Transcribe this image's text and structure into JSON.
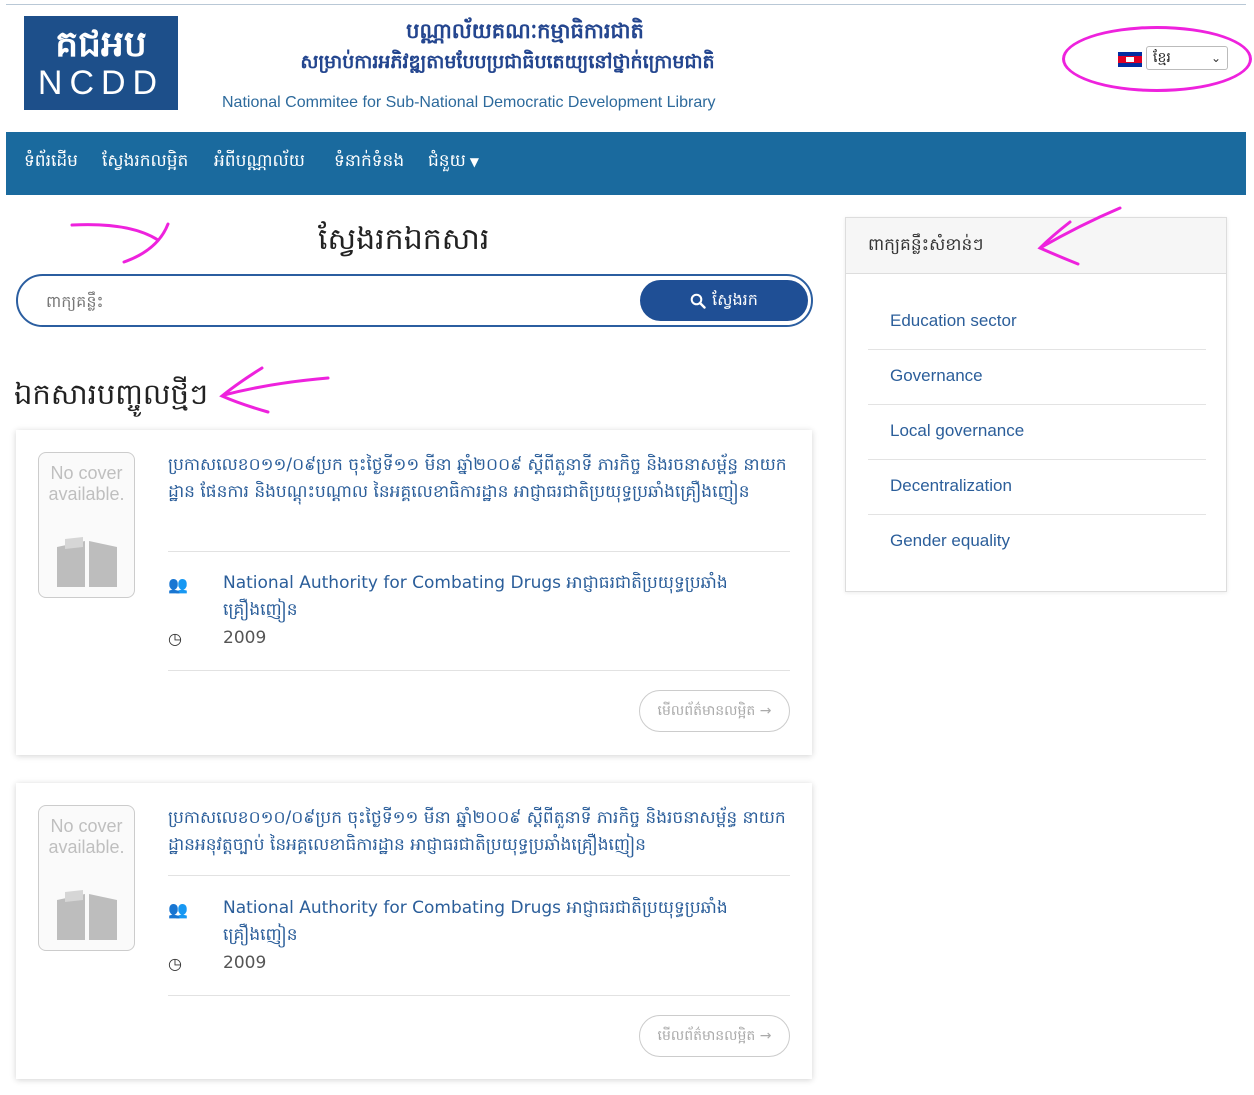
{
  "header": {
    "logo_khmer": "គជអប",
    "logo_latin": "NCDD",
    "title_khmer_line1": "បណ្ណាល័យគណៈកម្មាធិការជាតិ",
    "title_khmer_line2": "សម្រាប់ការអភិវឌ្ឍតាមបែបប្រជាធិបតេយ្យនៅថ្នាក់ក្រោមជាតិ",
    "title_english": "National Commitee for Sub-National Democratic Development Library",
    "language": {
      "selected": "ខ្មែរ",
      "flag_icon": "cambodia-flag-icon"
    }
  },
  "nav": {
    "items": [
      {
        "label": "ទំព័រដើម"
      },
      {
        "label": "ស្វែងរកលម្អិត"
      },
      {
        "label": "អំពីបណ្ណាល័យ"
      },
      {
        "label": "ទំនាក់ទំនង"
      },
      {
        "label": "ជំនួយ"
      }
    ]
  },
  "search": {
    "title": "ស្វែងរកឯកសារ",
    "placeholder": "ពាក្យគន្លឹះ",
    "button_label": "ស្វែងរក"
  },
  "recent": {
    "title": "ឯកសារបញ្ចូលថ្មីៗ",
    "items": [
      {
        "cover_text": "No cover available.",
        "title": "ប្រកាសលេខ០១១/០៩ប្រក ចុះថ្ងៃទី១១ មីនា ឆ្នាំ២០០៩ ស្តីពីតួនាទី ភារកិច្ច និងរចនាសម្ព័ន្ធ នាយកដ្ឋាន ផែនការ និងបណ្តុះបណ្តាល នៃអគ្គលេខាធិការដ្ឋាន អាជ្ញាធរជាតិប្រយុទ្ធប្រឆាំងគ្រឿងញៀន",
        "author": "National Authority for Combating Drugs អាជ្ញាធរជាតិប្រយុទ្ធប្រឆាំងគ្រឿងញៀន",
        "year": "2009",
        "more_label": "មើលព័ត៌មានលម្អិត →"
      },
      {
        "cover_text": "No cover available.",
        "title": "ប្រកាសលេខ០១០/០៩ប្រក ចុះថ្ងៃទី១១ មីនា ឆ្នាំ២០០៩ ស្តីពីតួនាទី ភារកិច្ច និងរចនាសម្ព័ន្ធ នាយកដ្ឋានអនុវត្តច្បាប់ នៃអគ្គលេខាធិការដ្ឋាន អាជ្ញាធរជាតិប្រយុទ្ធប្រឆាំងគ្រឿងញៀន",
        "author": "National Authority for Combating Drugs អាជ្ញាធរជាតិប្រយុទ្ធប្រឆាំងគ្រឿងញៀន",
        "year": "2009",
        "more_label": "មើលព័ត៌មានលម្អិត →"
      }
    ]
  },
  "sidebar": {
    "title": "ពាក្យគន្លឹះសំខាន់ៗ",
    "keywords": [
      "Education sector",
      "Governance",
      "Local governance",
      "Decentralization",
      "Gender equality"
    ]
  },
  "colors": {
    "nav_bg": "#1a6a9e",
    "brand_blue": "#1d4f8a",
    "link_blue": "#2b5e9a",
    "annotation_magenta": "#ee22dd"
  }
}
